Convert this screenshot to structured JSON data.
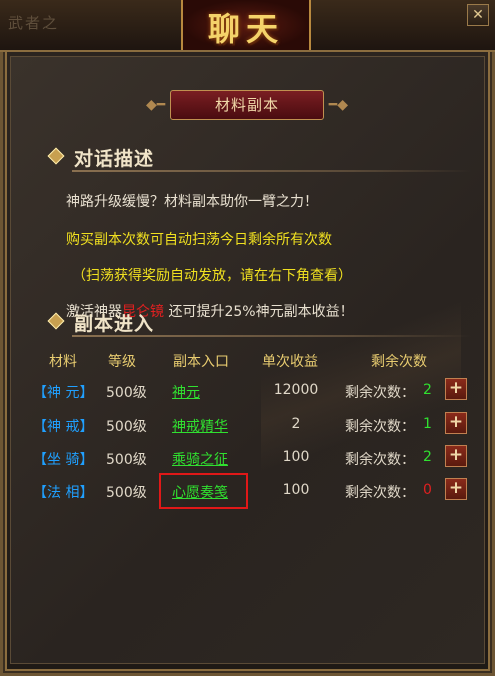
{
  "window": {
    "title": "聊天",
    "bg_deco_text": "武者之",
    "close_symbol": "✕"
  },
  "plaque": {
    "label": "材料副本"
  },
  "dialog": {
    "heading": "对话描述",
    "lines": [
      {
        "text": "神路升级缓慢？材料副本助你一臂之力！",
        "color": "white"
      },
      {
        "text": "购买副本次数可自动扫荡今日剩余所有次数",
        "color": "yellow"
      },
      {
        "text": "（扫荡获得奖励自动发放，请在右下角查看）",
        "color": "yellow"
      }
    ],
    "boost": {
      "prefix": "激活神器",
      "item": "昆仑镜",
      "suffix": "还可提升25%神元副本收益！"
    }
  },
  "dungeon": {
    "heading": "副本进入",
    "columns": [
      "材料",
      "等级",
      "副本入口",
      "单次收益",
      "剩余次数"
    ],
    "rows": [
      {
        "material": "【神 元】",
        "level": "500级",
        "entry": "神元",
        "gain": "12000",
        "remain_label": "剩余次数：",
        "remain": "2",
        "remain_color": "green"
      },
      {
        "material": "【神 戒】",
        "level": "500级",
        "entry": "神戒精华",
        "gain": "2",
        "remain_label": "剩余次数：",
        "remain": "1",
        "remain_color": "green"
      },
      {
        "material": "【坐 骑】",
        "level": "500级",
        "entry": "乘骑之征",
        "gain": "100",
        "remain_label": "剩余次数：",
        "remain": "2",
        "remain_color": "green"
      },
      {
        "material": "【法 相】",
        "level": "500级",
        "entry": "心愿奏笺",
        "gain": "100",
        "remain_label": "剩余次数：",
        "remain": "0",
        "remain_color": "red"
      }
    ],
    "plus_symbol": "+"
  }
}
